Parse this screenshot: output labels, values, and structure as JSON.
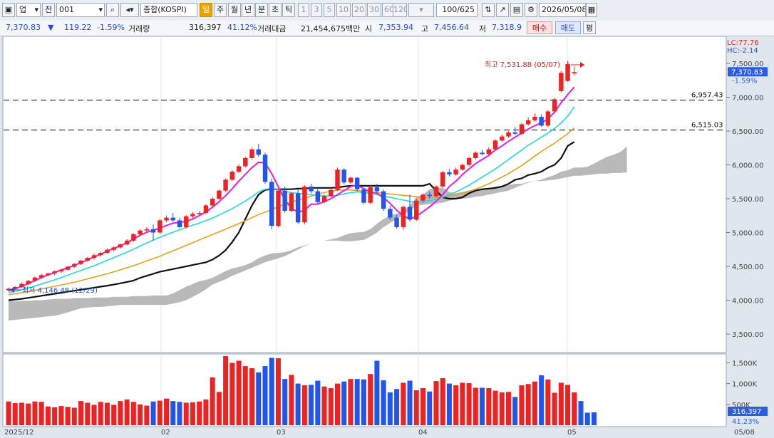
{
  "toolbar": {
    "market": "업",
    "period_type": "전",
    "code": "001",
    "name": "종합(KOSPI)",
    "intervals": [
      "일",
      "주",
      "월",
      "년",
      "분",
      "초",
      "틱"
    ],
    "active_interval": "일",
    "minute_values": [
      "1",
      "3",
      "5",
      "10",
      "20",
      "30",
      "60",
      "120"
    ],
    "count": "100/625",
    "date": "2026/05/08"
  },
  "info": {
    "price": "7,370.83",
    "change": "119.22",
    "change_pct": "-1.59%",
    "volume_label": "거래량",
    "volume": "316,397",
    "volume_pct": "41.12%",
    "amount_label": "거래대금",
    "amount": "21,454,675백만",
    "open_label": "시",
    "open": "7,353.94",
    "high_label": "고",
    "high": "7,456.64",
    "low_label": "저",
    "low": "7,318.9",
    "buy": "매수",
    "sell": "매도",
    "eval": "평"
  },
  "chart": {
    "lc": "LC:77.76",
    "hc": "HC:-2.14",
    "price_ticks": [
      "7,500.00",
      "7,000.00",
      "6,500.00",
      "6,000.00",
      "5,500.00",
      "5,000.00",
      "4,500.00",
      "4,000.00",
      "3,500.00"
    ],
    "price_tick_values": [
      7500,
      7000,
      6500,
      6000,
      5500,
      5000,
      4500,
      4000,
      3500
    ],
    "current_price": "7,370.83",
    "current_price_value": 7370.83,
    "current_pct": "-1.59%",
    "hlines": [
      {
        "label": "6,957.43",
        "value": 6957.43
      },
      {
        "label": "6,515.03",
        "value": 6515.03
      }
    ],
    "max_annotation": "최고 7,531.88 (05/07)",
    "min_annotation": "최저 4,146.48 (12/29)",
    "x_labels": [
      "2025/12",
      "02",
      "03",
      "04",
      "05",
      "05/08"
    ],
    "vol_ticks": [
      "1,500K",
      "1,000K",
      "500K"
    ],
    "vol_tick_values": [
      1500,
      1000,
      500
    ],
    "current_volume": "316,397",
    "current_volume_pct": "41.23%",
    "colors": {
      "up": "#ee2222",
      "down": "#2255ee",
      "ma5": "#e81be8",
      "ma10": "#22d8e8",
      "ma20": "#e6a21a",
      "ma60": "#111111",
      "cloud": "#b9b9b9"
    }
  },
  "chart_data": {
    "type": "candlestick",
    "title": "종합(KOSPI)",
    "y_range": [
      3300,
      7700
    ],
    "volume_range_k": [
      0,
      1700
    ],
    "candles": [
      [
        4146,
        4185,
        4130,
        4170
      ],
      [
        4170,
        4210,
        4150,
        4195
      ],
      [
        4195,
        4260,
        4180,
        4240
      ],
      [
        4240,
        4300,
        4225,
        4285
      ],
      [
        4285,
        4350,
        4270,
        4335
      ],
      [
        4335,
        4390,
        4315,
        4370
      ],
      [
        4370,
        4410,
        4350,
        4395
      ],
      [
        4395,
        4440,
        4370,
        4425
      ],
      [
        4425,
        4470,
        4400,
        4450
      ],
      [
        4450,
        4510,
        4440,
        4495
      ],
      [
        4495,
        4550,
        4480,
        4535
      ],
      [
        4535,
        4600,
        4520,
        4585
      ],
      [
        4585,
        4640,
        4570,
        4625
      ],
      [
        4625,
        4690,
        4600,
        4665
      ],
      [
        4665,
        4720,
        4645,
        4700
      ],
      [
        4700,
        4760,
        4690,
        4745
      ],
      [
        4745,
        4800,
        4720,
        4780
      ],
      [
        4780,
        4840,
        4760,
        4825
      ],
      [
        4825,
        4900,
        4810,
        4880
      ],
      [
        4880,
        4990,
        4860,
        4975
      ],
      [
        4975,
        5050,
        4950,
        5030
      ],
      [
        5030,
        5080,
        4990,
        5050
      ],
      [
        5050,
        5120,
        4880,
        5000
      ],
      [
        5000,
        5200,
        4980,
        5180
      ],
      [
        5180,
        5250,
        5150,
        5220
      ],
      [
        5220,
        5290,
        5160,
        5180
      ],
      [
        5180,
        5220,
        5060,
        5080
      ],
      [
        5080,
        5260,
        5060,
        5240
      ],
      [
        5240,
        5300,
        5210,
        5275
      ],
      [
        5275,
        5320,
        5240,
        5290
      ],
      [
        5290,
        5420,
        5270,
        5400
      ],
      [
        5400,
        5520,
        5380,
        5500
      ],
      [
        5500,
        5640,
        5480,
        5620
      ],
      [
        5620,
        5800,
        5600,
        5780
      ],
      [
        5780,
        5920,
        5760,
        5900
      ],
      [
        5900,
        6010,
        5880,
        5980
      ],
      [
        5980,
        6120,
        5960,
        6100
      ],
      [
        6100,
        6260,
        6080,
        6230
      ],
      [
        6230,
        6310,
        6120,
        6150
      ],
      [
        6150,
        6180,
        5720,
        5750
      ],
      [
        5750,
        5800,
        5050,
        5100
      ],
      [
        5100,
        5640,
        5080,
        5620
      ],
      [
        5620,
        5680,
        5290,
        5320
      ],
      [
        5320,
        5600,
        5300,
        5580
      ],
      [
        5580,
        5640,
        5130,
        5150
      ],
      [
        5150,
        5700,
        5120,
        5680
      ],
      [
        5680,
        5720,
        5580,
        5610
      ],
      [
        5610,
        5660,
        5420,
        5450
      ],
      [
        5450,
        5560,
        5430,
        5540
      ],
      [
        5540,
        5650,
        5520,
        5630
      ],
      [
        5630,
        5960,
        5610,
        5930
      ],
      [
        5930,
        5950,
        5710,
        5740
      ],
      [
        5740,
        5830,
        5720,
        5810
      ],
      [
        5810,
        5820,
        5610,
        5640
      ],
      [
        5640,
        5650,
        5420,
        5440
      ],
      [
        5440,
        5700,
        5420,
        5670
      ],
      [
        5670,
        5720,
        5580,
        5610
      ],
      [
        5610,
        5640,
        5320,
        5350
      ],
      [
        5350,
        5400,
        5180,
        5220
      ],
      [
        5220,
        5260,
        5060,
        5080
      ],
      [
        5080,
        5400,
        5040,
        5380
      ],
      [
        5380,
        5560,
        5160,
        5190
      ],
      [
        5190,
        5500,
        5170,
        5470
      ],
      [
        5470,
        5580,
        5450,
        5560
      ],
      [
        5560,
        5600,
        5500,
        5540
      ],
      [
        5540,
        5700,
        5520,
        5680
      ],
      [
        5680,
        5910,
        5660,
        5890
      ],
      [
        5890,
        5940,
        5830,
        5860
      ],
      [
        5860,
        5960,
        5840,
        5930
      ],
      [
        5930,
        6020,
        5910,
        6000
      ],
      [
        6000,
        6120,
        5980,
        6100
      ],
      [
        6100,
        6200,
        6080,
        6180
      ],
      [
        6180,
        6220,
        6140,
        6160
      ],
      [
        6160,
        6260,
        6140,
        6230
      ],
      [
        6230,
        6380,
        6210,
        6360
      ],
      [
        6360,
        6450,
        6340,
        6420
      ],
      [
        6420,
        6500,
        6400,
        6480
      ],
      [
        6480,
        6560,
        6440,
        6460
      ],
      [
        6460,
        6620,
        6440,
        6600
      ],
      [
        6600,
        6700,
        6580,
        6660
      ],
      [
        6660,
        6760,
        6640,
        6710
      ],
      [
        6710,
        6750,
        6560,
        6580
      ],
      [
        6580,
        6810,
        6560,
        6790
      ],
      [
        6790,
        6990,
        6770,
        6970
      ],
      [
        7090,
        7390,
        7070,
        7360
      ],
      [
        7240,
        7532,
        7230,
        7490
      ],
      [
        7353,
        7457,
        7319,
        7371
      ]
    ],
    "volume_k": [
      570,
      530,
      540,
      520,
      570,
      560,
      450,
      430,
      460,
      440,
      420,
      580,
      540,
      490,
      560,
      540,
      490,
      580,
      620,
      560,
      500,
      470,
      570,
      590,
      640,
      580,
      560,
      540,
      550,
      570,
      620,
      1150,
      800,
      1660,
      1500,
      1550,
      1420,
      1370,
      1270,
      1420,
      1620,
      1610,
      1110,
      1210,
      1000,
      960,
      970,
      1070,
      930,
      890,
      1000,
      1050,
      1110,
      1110,
      1100,
      1230,
      1550,
      1080,
      790,
      870,
      1020,
      1070,
      840,
      890,
      810,
      1060,
      1130,
      1000,
      960,
      1020,
      1010,
      900,
      900,
      890,
      830,
      790,
      800,
      680,
      960,
      990,
      1050,
      1200,
      1100,
      780,
      1020,
      970,
      790,
      580,
      300,
      310
    ],
    "ma5": [
      4135,
      4170,
      4205,
      4245,
      4290,
      4335,
      4375,
      4410,
      4445,
      4480,
      4515,
      4555,
      4595,
      4640,
      4680,
      4725,
      4765,
      4805,
      4850,
      4905,
      4960,
      5005,
      5035,
      5065,
      5105,
      5140,
      5150,
      5165,
      5200,
      5250,
      5305,
      5375,
      5455,
      5545,
      5650,
      5760,
      5860,
      5960,
      6040,
      6030,
      5870,
      5680,
      5480,
      5360,
      5300,
      5330,
      5420,
      5420,
      5460,
      5500,
      5560,
      5620,
      5680,
      5700,
      5650,
      5600,
      5580,
      5520,
      5430,
      5330,
      5250,
      5200,
      5240,
      5310,
      5380,
      5460,
      5560,
      5680,
      5760,
      5860,
      5940,
      6020,
      6080,
      6140,
      6220,
      6280,
      6350,
      6410,
      6470,
      6530,
      6580,
      6620,
      6680,
      6780,
      6920,
      7040,
      7150
    ],
    "ma10": [
      4110,
      4130,
      4155,
      4180,
      4210,
      4240,
      4270,
      4300,
      4335,
      4370,
      4405,
      4440,
      4475,
      4510,
      4550,
      4590,
      4630,
      4670,
      4710,
      4755,
      4800,
      4845,
      4890,
      4930,
      4970,
      5005,
      5040,
      5075,
      5110,
      5140,
      5175,
      5215,
      5260,
      5305,
      5355,
      5410,
      5465,
      5530,
      5600,
      5640,
      5650,
      5640,
      5610,
      5590,
      5580,
      5570,
      5560,
      5550,
      5540,
      5540,
      5550,
      5570,
      5590,
      5600,
      5590,
      5580,
      5560,
      5540,
      5520,
      5500,
      5480,
      5460,
      5450,
      5450,
      5470,
      5490,
      5520,
      5560,
      5600,
      5650,
      5700,
      5760,
      5820,
      5880,
      5940,
      6010,
      6080,
      6150,
      6220,
      6290,
      6350,
      6410,
      6470,
      6540,
      6620,
      6720,
      6860
    ],
    "ma20": [
      4080,
      4095,
      4110,
      4125,
      4145,
      4165,
      4185,
      4205,
      4225,
      4245,
      4265,
      4290,
      4315,
      4340,
      4365,
      4390,
      4420,
      4450,
      4480,
      4510,
      4545,
      4580,
      4615,
      4650,
      4690,
      4730,
      4770,
      4810,
      4850,
      4890,
      4930,
      4970,
      5010,
      5050,
      5090,
      5130,
      5175,
      5220,
      5265,
      5300,
      5340,
      5380,
      5420,
      5450,
      5480,
      5510,
      5540,
      5570,
      5590,
      5610,
      5625,
      5630,
      5630,
      5620,
      5610,
      5600,
      5590,
      5580,
      5570,
      5560,
      5550,
      5540,
      5530,
      5520,
      5520,
      5520,
      5530,
      5540,
      5560,
      5580,
      5610,
      5640,
      5680,
      5720,
      5770,
      5820,
      5870,
      5930,
      5990,
      6060,
      6130,
      6200,
      6260,
      6320,
      6390,
      6460,
      6550
    ],
    "ma60": [
      4000,
      4010,
      4020,
      4035,
      4050,
      4065,
      4080,
      4095,
      4110,
      4125,
      4140,
      4155,
      4170,
      4185,
      4200,
      4215,
      4230,
      4250,
      4270,
      4290,
      4330,
      4360,
      4390,
      4420,
      4440,
      4460,
      4480,
      4500,
      4520,
      4540,
      4560,
      4600,
      4660,
      4740,
      4860,
      5000,
      5200,
      5400,
      5560,
      5630,
      5640,
      5640,
      5640,
      5640,
      5650,
      5650,
      5660,
      5660,
      5660,
      5660,
      5665,
      5680,
      5690,
      5690,
      5690,
      5690,
      5690,
      5690,
      5690,
      5690,
      5690,
      5690,
      5690,
      5690,
      5720,
      5620,
      5520,
      5500,
      5500,
      5520,
      5580,
      5620,
      5640,
      5650,
      5660,
      5680,
      5720,
      5780,
      5800,
      5850,
      5870,
      5900,
      5960,
      6000,
      6100,
      6280,
      6340
    ],
    "cloud_top": [
      4000,
      3980,
      3990,
      3990,
      4000,
      4000,
      4010,
      4020,
      4020,
      4020,
      4030,
      4030,
      4030,
      4040,
      4040,
      4040,
      4050,
      4050,
      4050,
      4060,
      4060,
      4060,
      4070,
      4070,
      4070,
      4100,
      4150,
      4200,
      4240,
      4280,
      4300,
      4330,
      4380,
      4430,
      4470,
      4490,
      4520,
      4560,
      4620,
      4660,
      4690,
      4700,
      4710,
      4740,
      4780,
      4810,
      4840,
      4870,
      4880,
      4900,
      4920,
      4960,
      4990,
      5000,
      5010,
      5050,
      5130,
      5200,
      5250,
      5280,
      5310,
      5400,
      5520,
      5560,
      5640,
      5660,
      5660,
      5600,
      5580,
      5600,
      5620,
      5640,
      5640,
      5650,
      5680,
      5690,
      5700,
      5720,
      5720,
      5750,
      5760,
      5780,
      5820,
      5850,
      5900,
      5920,
      5960,
      5960,
      5970,
      6020,
      6070,
      6120,
      6150,
      6190,
      6270
    ],
    "cloud_bot": [
      3700,
      3710,
      3720,
      3730,
      3740,
      3750,
      3760,
      3770,
      3790,
      3820,
      3850,
      3880,
      3890,
      3900,
      3900,
      3910,
      3920,
      3930,
      3930,
      3930,
      3930,
      3930,
      3930,
      3930,
      3930,
      3950,
      3970,
      4000,
      4050,
      4100,
      4160,
      4230,
      4270,
      4310,
      4360,
      4400,
      4440,
      4480,
      4520,
      4560,
      4590,
      4620,
      4650,
      4700,
      4750,
      4800,
      4840,
      4870,
      4880,
      4880,
      4880,
      4870,
      4870,
      4880,
      4890,
      4940,
      5000,
      5080,
      5140,
      5200,
      5260,
      5330,
      5390,
      5410,
      5420,
      5430,
      5440,
      5470,
      5490,
      5500,
      5510,
      5530,
      5540,
      5560,
      5580,
      5600,
      5620,
      5660,
      5700,
      5740,
      5760,
      5760,
      5770,
      5780,
      5800,
      5820,
      5840,
      5840,
      5850,
      5860,
      5870,
      5870,
      5880,
      5880,
      5890
    ]
  }
}
